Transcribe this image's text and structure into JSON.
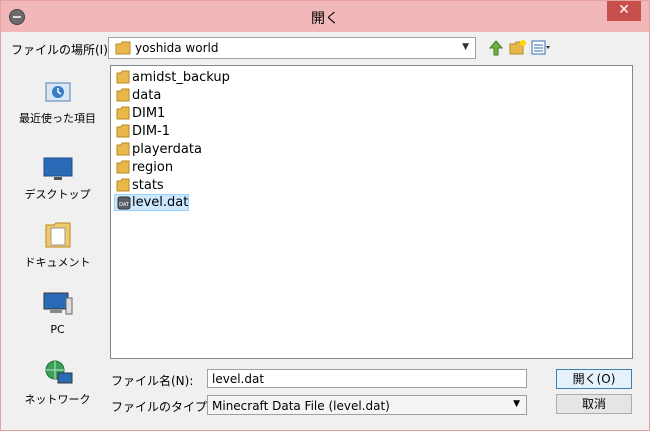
{
  "window": {
    "title": "開く",
    "close": "✕"
  },
  "location": {
    "label": "ファイルの場所(I):",
    "value": "yoshida world"
  },
  "places": [
    {
      "label": "最近使った項目",
      "icon": "recent-icon"
    },
    {
      "label": "デスクトップ",
      "icon": "desktop-icon"
    },
    {
      "label": "ドキュメント",
      "icon": "documents-icon"
    },
    {
      "label": "PC",
      "icon": "pc-icon"
    },
    {
      "label": "ネットワーク",
      "icon": "network-icon"
    }
  ],
  "files": [
    {
      "name": "amidst_backup",
      "type": "folder"
    },
    {
      "name": "data",
      "type": "folder"
    },
    {
      "name": "DIM1",
      "type": "folder"
    },
    {
      "name": "DIM-1",
      "type": "folder"
    },
    {
      "name": "playerdata",
      "type": "folder"
    },
    {
      "name": "region",
      "type": "folder"
    },
    {
      "name": "stats",
      "type": "folder"
    },
    {
      "name": "level.dat",
      "type": "file",
      "selected": true,
      "badge": "DAT"
    }
  ],
  "filename": {
    "label": "ファイル名(N):",
    "value": "level.dat"
  },
  "filetype": {
    "label": "ファイルのタイプ(T):",
    "value": "Minecraft Data File (level.dat)"
  },
  "buttons": {
    "open": "開く(O)",
    "cancel": "取消"
  },
  "colors": {
    "titlebar": "#f2b7b8",
    "close": "#c7504c",
    "selection": "#cce8ff",
    "folder": "#e8b84a"
  }
}
